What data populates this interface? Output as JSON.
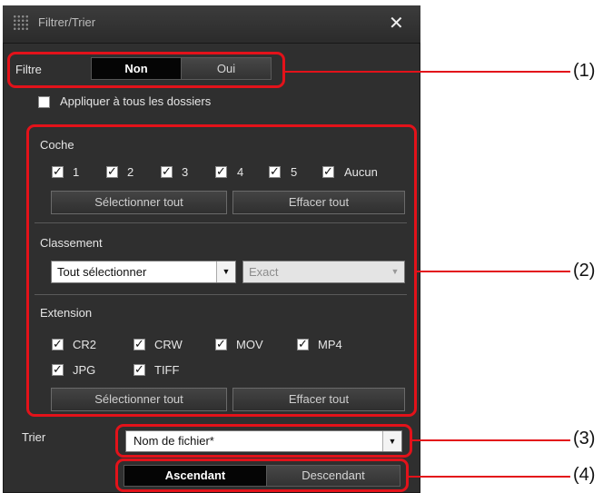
{
  "window": {
    "title": "Filtrer/Trier"
  },
  "filtre": {
    "label": "Filtre",
    "non": "Non",
    "oui": "Oui"
  },
  "apply_all": "Appliquer à tous les dossiers",
  "coche": {
    "label": "Coche",
    "items": [
      "1",
      "2",
      "3",
      "4",
      "5",
      "Aucun"
    ],
    "select_all": "Sélectionner tout",
    "clear_all": "Effacer tout"
  },
  "classement": {
    "label": "Classement",
    "select_value": "Tout sélectionner",
    "exact_value": "Exact"
  },
  "extension": {
    "label": "Extension",
    "items": [
      "CR2",
      "CRW",
      "MOV",
      "MP4",
      "JPG",
      "TIFF"
    ],
    "select_all": "Sélectionner tout",
    "clear_all": "Effacer tout"
  },
  "trier": {
    "label": "Trier",
    "select_value": "Nom de fichier*",
    "ascendant": "Ascendant",
    "descendant": "Descendant"
  },
  "callouts": [
    "(1)",
    "(2)",
    "(3)",
    "(4)"
  ],
  "colors": {
    "highlight": "#e3121a",
    "panel": "#2f2f2f"
  }
}
